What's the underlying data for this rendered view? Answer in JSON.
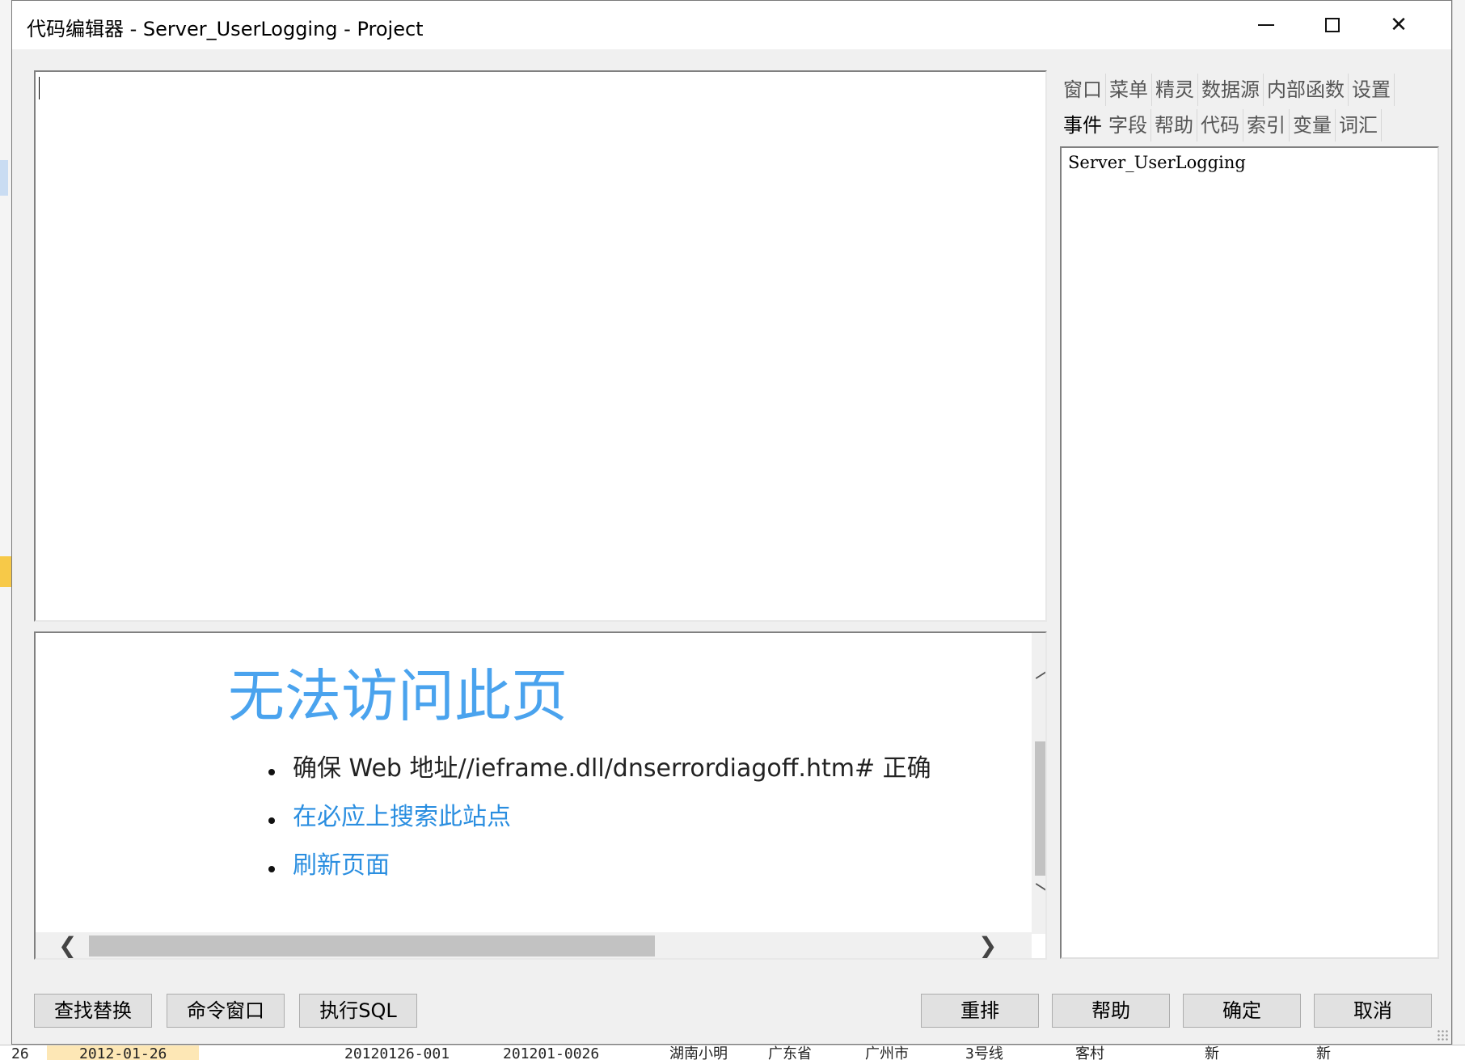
{
  "window": {
    "title": "代码编辑器 - Server_UserLogging - Project"
  },
  "editor": {
    "content": ""
  },
  "browser": {
    "heading": "无法访问此页",
    "items": [
      {
        "text": "确保 Web 地址//ieframe.dll/dnserrordiagoff.htm# 正确",
        "kind": "plain"
      },
      {
        "text": "在必应上搜索此站点",
        "kind": "link"
      },
      {
        "text": "刷新页面",
        "kind": "link"
      }
    ]
  },
  "tabs": {
    "row1": [
      "窗口",
      "菜单",
      "精灵",
      "数据源",
      "内部函数",
      "设置"
    ],
    "row2": [
      "事件",
      "字段",
      "帮助",
      "代码",
      "索引",
      "变量",
      "词汇"
    ],
    "active": "事件"
  },
  "tree": {
    "items": [
      "Server_UserLogging"
    ]
  },
  "buttons": {
    "find_replace": "查找替换",
    "command_window": "命令窗口",
    "execute_sql": "执行SQL",
    "rearrange": "重排",
    "help": "帮助",
    "ok": "确定",
    "cancel": "取消"
  },
  "background_row": {
    "row_no": "26",
    "date": "2012-01-26",
    "col1": "20120126-001",
    "col2": "201201-0026",
    "col3": "湖南小明",
    "col4": "广东省",
    "col5": "广州市",
    "col6": "3号线",
    "col7": "客村",
    "col8": "新",
    "col9": "新"
  },
  "colors": {
    "heading_blue": "#4aa3ee",
    "link_blue": "#2a8ee0",
    "window_bg": "#f0f0f0"
  }
}
